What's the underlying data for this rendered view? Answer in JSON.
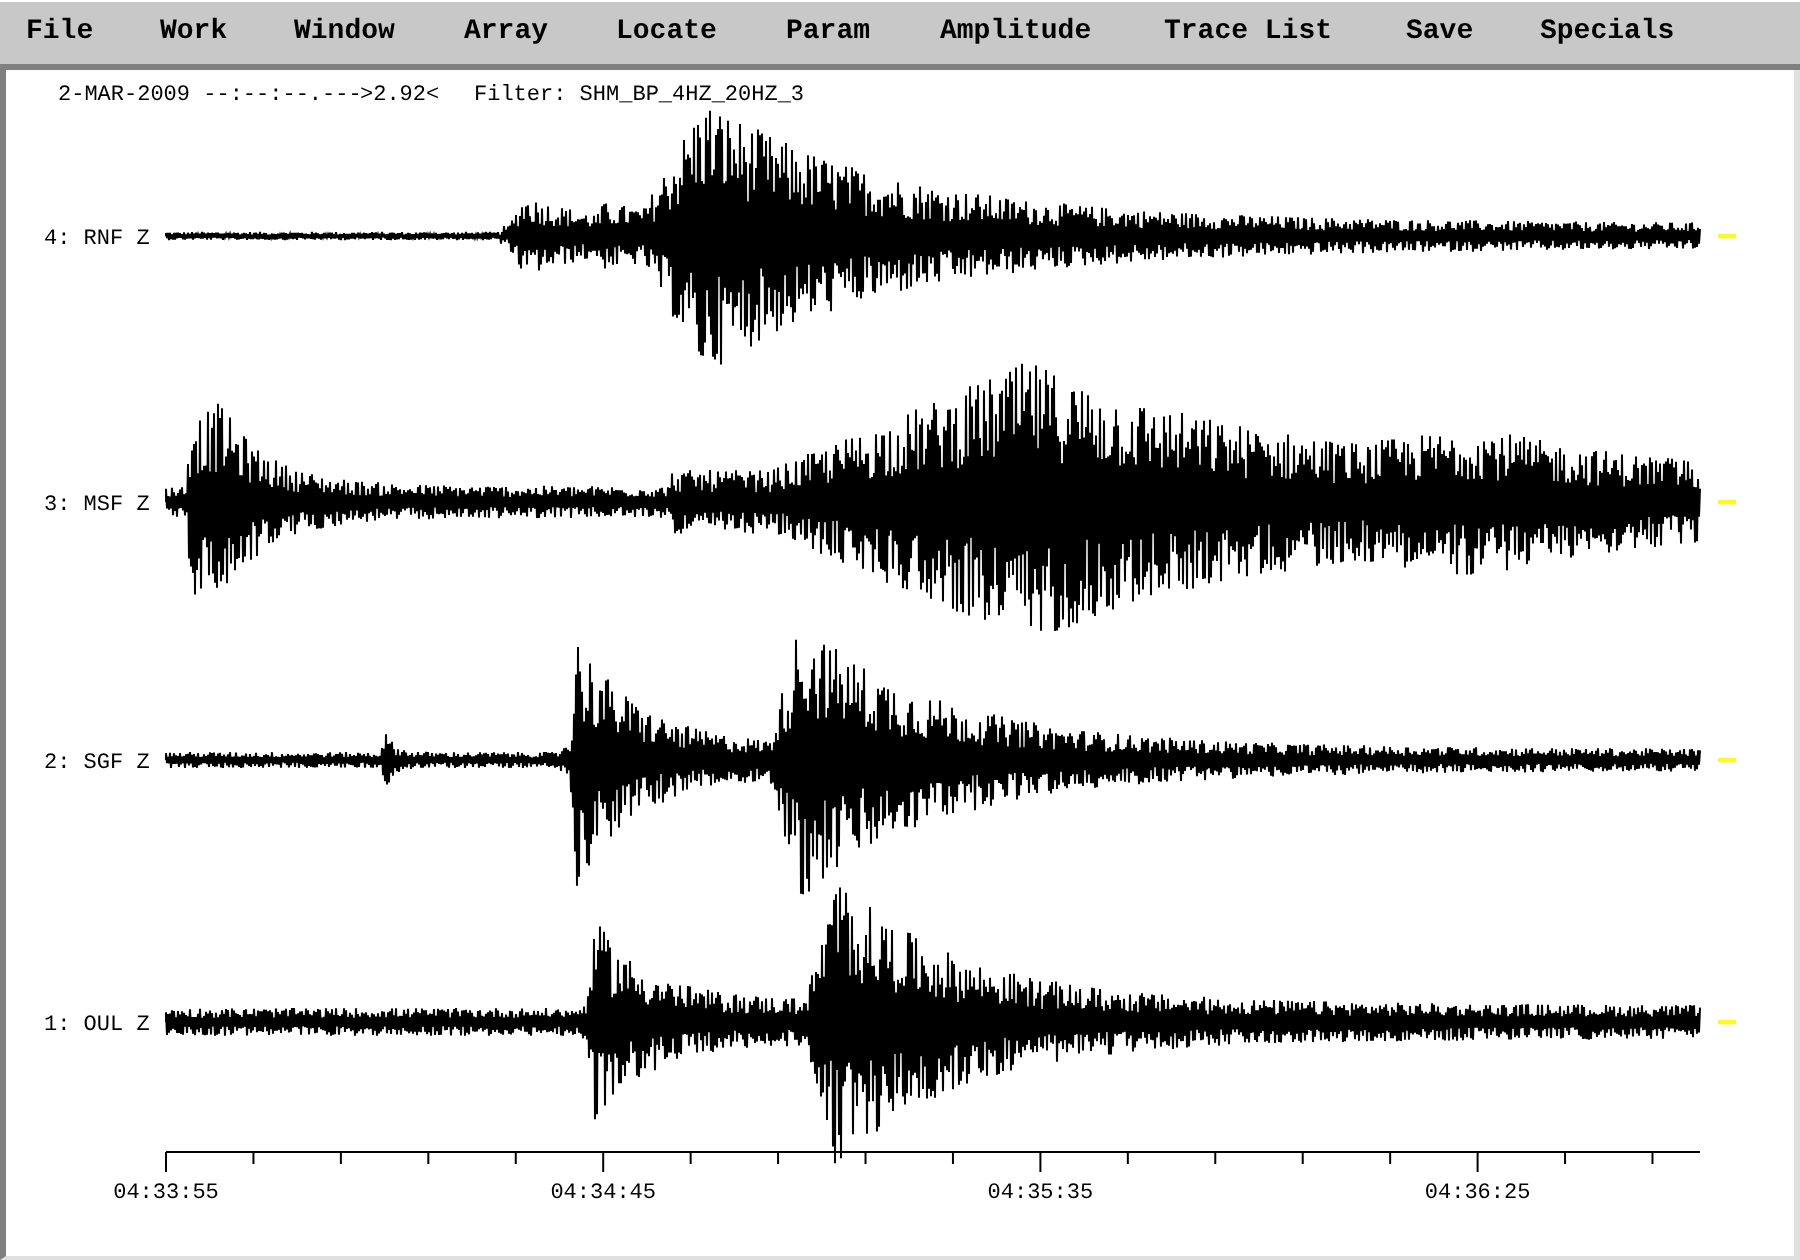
{
  "menu": [
    {
      "label": "File"
    },
    {
      "label": "Work"
    },
    {
      "label": "Window"
    },
    {
      "label": "Array"
    },
    {
      "label": "Locate"
    },
    {
      "label": "Param"
    },
    {
      "label": "Amplitude"
    },
    {
      "label": "Trace List"
    },
    {
      "label": "Save"
    },
    {
      "label": "Specials"
    }
  ],
  "header": {
    "date": "2-MAR-2009 --:--:--.---",
    "value": ">2.92<",
    "filter": "Filter: SHM_BP_4HZ_20HZ_3"
  },
  "traces": [
    {
      "label": "4: RNF Z"
    },
    {
      "label": "3: MSF Z"
    },
    {
      "label": "2: SGF Z"
    },
    {
      "label": "1: OUL Z"
    }
  ],
  "time_axis": {
    "labels": [
      "04:33:55",
      "04:34:45",
      "04:35:35",
      "04:36:25"
    ]
  }
}
